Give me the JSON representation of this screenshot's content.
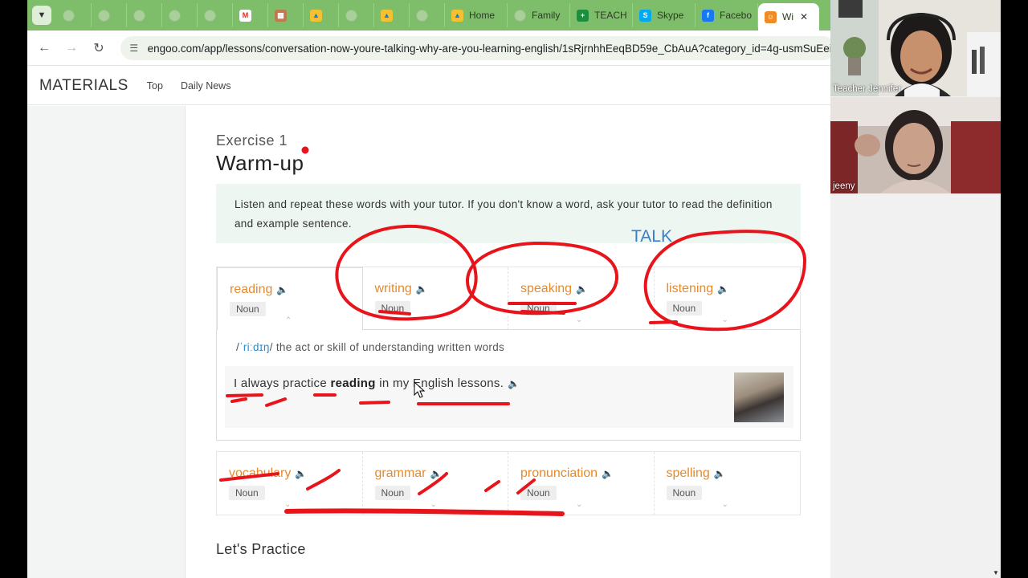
{
  "browser": {
    "tabs": [
      {
        "label": "",
        "icon": "blank-tab-icon"
      },
      {
        "label": "",
        "icon": "blank-tab-icon"
      },
      {
        "label": "",
        "icon": "blank-tab-icon"
      },
      {
        "label": "",
        "icon": "blank-tab-icon"
      },
      {
        "label": "",
        "icon": "blank-tab-icon"
      },
      {
        "label": "",
        "icon": "gmail-icon"
      },
      {
        "label": "",
        "icon": "slides-icon"
      },
      {
        "label": "",
        "icon": "drive-icon"
      },
      {
        "label": "",
        "icon": "blank-tab-icon"
      },
      {
        "label": "",
        "icon": "drive-icon"
      },
      {
        "label": "",
        "icon": "blank-tab-icon"
      },
      {
        "label": "Home",
        "icon": "drive-icon"
      },
      {
        "label": "Family",
        "icon": "blank-tab-icon"
      },
      {
        "label": "TEACH",
        "icon": "sheets-icon"
      },
      {
        "label": "Skype",
        "icon": "skype-icon"
      },
      {
        "label": "Facebo",
        "icon": "facebook-icon"
      },
      {
        "label": "Wi",
        "icon": "engoo-icon",
        "active": true
      }
    ],
    "close_glyph": "✕",
    "url": "engoo.com/app/lessons/conversation-now-youre-talking-why-are-you-learning-english/1sRjrnhhEeqBD59e_CbAuA?category_id=4g-usmSuEeirT..."
  },
  "site": {
    "brand": "MATERIALS",
    "nav": [
      "Top",
      "Daily News"
    ]
  },
  "lesson": {
    "exercise_label": "Exercise 1",
    "exercise_title": "Warm-up",
    "instruction": "Listen and repeat these words with your tutor. If you don't know a word, ask your tutor to read the definition and example sentence.",
    "row1": [
      {
        "word": "reading",
        "pos": "Noun"
      },
      {
        "word": "writing",
        "pos": "Noun"
      },
      {
        "word": "speaking",
        "pos": "Noun"
      },
      {
        "word": "listening",
        "pos": "Noun"
      }
    ],
    "definition": {
      "ipa": "ˈriːdɪŋ",
      "text": "the act or skill of understanding written words"
    },
    "example": {
      "before": "I always practice ",
      "bold": "reading",
      "after": " in my English lessons."
    },
    "row2": [
      {
        "word": "vocabulary",
        "pos": "Noun"
      },
      {
        "word": "grammar",
        "pos": "Noun"
      },
      {
        "word": "pronunciation",
        "pos": "Noun"
      },
      {
        "word": "spelling",
        "pos": "Noun"
      }
    ],
    "practice_heading": "Let's Practice"
  },
  "annotation": {
    "talk_label": "TALK",
    "pen_color": "#e8141c"
  },
  "video": {
    "participants": [
      "Teacher Jennifer",
      "jeeny"
    ]
  }
}
